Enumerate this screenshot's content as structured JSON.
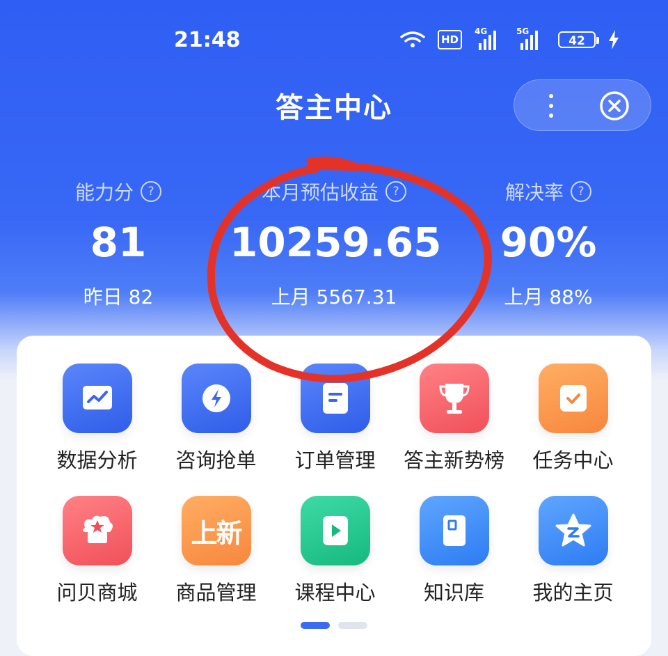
{
  "status_bar": {
    "time": "21:48",
    "hd": "HD",
    "net1": "4G",
    "net2": "5G",
    "battery": "42"
  },
  "header": {
    "title": "答主中心"
  },
  "stats": [
    {
      "label": "能力分",
      "value": "81",
      "sub": "昨日 82"
    },
    {
      "label": "本月预估收益",
      "value": "10259.65",
      "sub": "上月 5567.31"
    },
    {
      "label": "解决率",
      "value": "90%",
      "sub": "上月 88%"
    }
  ],
  "grid": {
    "row1": [
      {
        "label": "数据分析",
        "icon": "chart-icon"
      },
      {
        "label": "咨询抢单",
        "icon": "lightning-icon"
      },
      {
        "label": "订单管理",
        "icon": "document-icon"
      },
      {
        "label": "答主新势榜",
        "icon": "trophy-icon"
      },
      {
        "label": "任务中心",
        "icon": "calendar-check-icon"
      }
    ],
    "row2": [
      {
        "label": "问贝商城",
        "icon": "shop-star-icon"
      },
      {
        "label": "商品管理",
        "icon_text": "上新"
      },
      {
        "label": "课程中心",
        "icon": "video-play-icon"
      },
      {
        "label": "知识库",
        "icon": "book-icon"
      },
      {
        "label": "我的主页",
        "icon": "star-z-icon"
      }
    ]
  },
  "colors": {
    "header_blue": "#2f5ef4",
    "annotation_red": "#e53228"
  }
}
